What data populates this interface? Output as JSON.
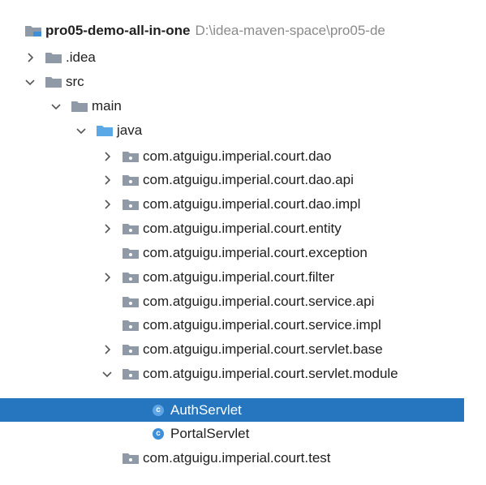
{
  "project": {
    "name": "pro05-demo-all-in-one",
    "path": "D:\\idea-maven-space\\pro05-de"
  },
  "tree": [
    {
      "label": ".idea",
      "arrow": "collapsed",
      "icon": "folder-icon"
    },
    {
      "label": "src",
      "arrow": "expanded",
      "icon": "folder-icon"
    },
    {
      "label": "main",
      "arrow": "expanded",
      "icon": "folder-icon"
    },
    {
      "label": "java",
      "arrow": "expanded",
      "icon": "source-folder-icon"
    },
    {
      "label": "com.atguigu.imperial.court.dao",
      "arrow": "collapsed",
      "icon": "package-icon"
    },
    {
      "label": "com.atguigu.imperial.court.dao.api",
      "arrow": "collapsed",
      "icon": "package-icon"
    },
    {
      "label": "com.atguigu.imperial.court.dao.impl",
      "arrow": "collapsed",
      "icon": "package-icon"
    },
    {
      "label": "com.atguigu.imperial.court.entity",
      "arrow": "collapsed",
      "icon": "package-icon"
    },
    {
      "label": "com.atguigu.imperial.court.exception",
      "arrow": "none",
      "icon": "package-icon"
    },
    {
      "label": "com.atguigu.imperial.court.filter",
      "arrow": "collapsed",
      "icon": "package-icon"
    },
    {
      "label": "com.atguigu.imperial.court.service.api",
      "arrow": "none",
      "icon": "package-icon"
    },
    {
      "label": "com.atguigu.imperial.court.service.impl",
      "arrow": "none",
      "icon": "package-icon"
    },
    {
      "label": "com.atguigu.imperial.court.servlet.base",
      "arrow": "collapsed",
      "icon": "package-icon"
    },
    {
      "label": "com.atguigu.imperial.court.servlet.module",
      "arrow": "expanded",
      "icon": "package-icon"
    },
    {
      "label": "AuthServlet",
      "arrow": "none",
      "icon": "class-icon",
      "icon_letter": "c",
      "selected": true
    },
    {
      "label": "PortalServlet",
      "arrow": "none",
      "icon": "class-icon",
      "icon_letter": "c"
    },
    {
      "label": "com.atguigu.imperial.court.test",
      "arrow": "none",
      "icon": "package-icon"
    }
  ],
  "colors": {
    "selection": "#2675bf",
    "folder": "#8f9aa6",
    "source_folder": "#5aa8e6",
    "class_icon": "#3d8fd8",
    "path_text": "#8a8a8a"
  }
}
